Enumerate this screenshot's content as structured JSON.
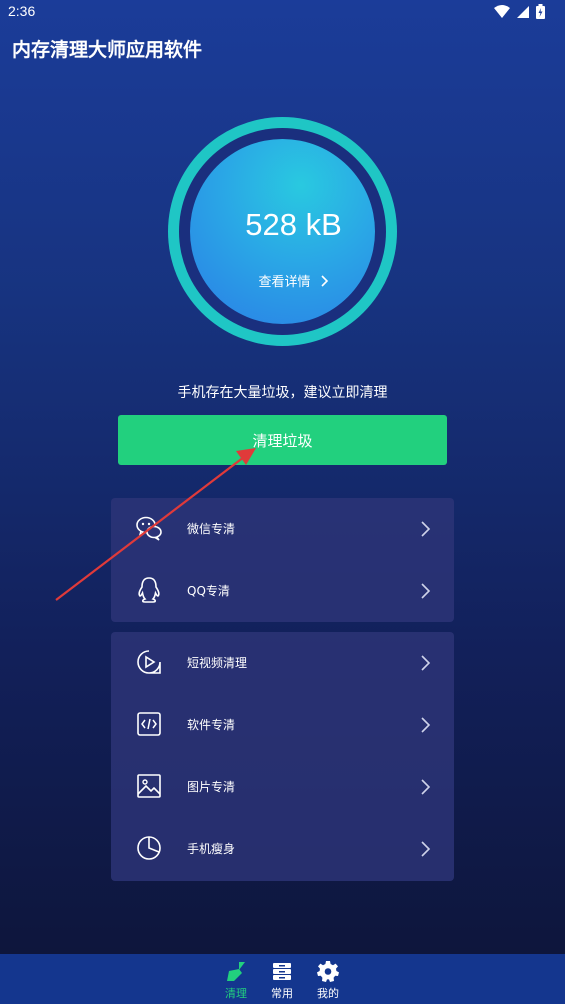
{
  "status_bar": {
    "time": "2:36"
  },
  "app": {
    "title": "内存清理大师应用软件"
  },
  "memory": {
    "size": "528 kB",
    "details_label": "查看详情"
  },
  "hint": "手机存在大量垃圾，建议立即清理",
  "clean_button": "清理垃圾",
  "card1": [
    {
      "label": "微信专清",
      "icon": "wechat-icon"
    },
    {
      "label": "QQ专清",
      "icon": "qq-icon"
    }
  ],
  "card2": [
    {
      "label": "短视频清理",
      "icon": "video-icon"
    },
    {
      "label": "软件专清",
      "icon": "code-icon"
    },
    {
      "label": "图片专清",
      "icon": "image-icon"
    },
    {
      "label": "手机瘦身",
      "icon": "pie-chart-icon"
    }
  ],
  "nav": [
    {
      "label": "清理",
      "icon": "broom-icon",
      "active": true
    },
    {
      "label": "常用",
      "icon": "drawer-icon",
      "active": false
    },
    {
      "label": "我的",
      "icon": "gear-icon",
      "active": false
    }
  ],
  "colors": {
    "accent_green": "#22d07e",
    "ring_teal": "#1fc6c5",
    "annotation_arrow": "#e03a3a"
  }
}
